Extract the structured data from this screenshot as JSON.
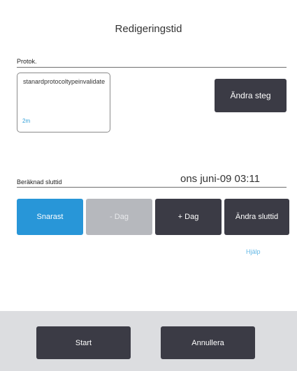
{
  "dialog": {
    "title": "Redigeringstid"
  },
  "protocol": {
    "section_label": "Protok.",
    "name": "stanardprotocoltypeinvalidate",
    "duration": "2m",
    "edit_steps_label": "Ändra steg"
  },
  "end_time": {
    "section_label": "Beräknad sluttid",
    "value": "ons juni-09 03:11"
  },
  "buttons": {
    "asap": "Snarast",
    "minus_day": "- Dag",
    "plus_day": "+ Dag",
    "change_end": "Ändra sluttid"
  },
  "help": "Hjälp",
  "footer": {
    "start": "Start",
    "cancel": "Annullera"
  },
  "colors": {
    "accent_blue": "#2896d8",
    "dark_button": "#3b3b45",
    "disabled_button": "#b6b8bd",
    "footer_background": "#dcdde0",
    "link": "#64b8e6"
  }
}
